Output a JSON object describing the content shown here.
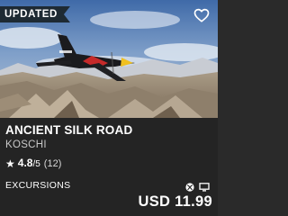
{
  "card": {
    "badge": "UPDATED",
    "title": "ANCIENT SILK ROAD",
    "publisher": "KOSCHI",
    "rating": {
      "score": "4.8",
      "out_of": "/5",
      "count": "(12)"
    },
    "category": "EXCURSIONS",
    "price": "USD 11.99",
    "platforms": [
      "xbox-icon",
      "pc-icon"
    ],
    "icons": {
      "wishlist": "heart-outline-icon",
      "star": "star-icon"
    },
    "colors": {
      "badge_bg": "#1e2a33",
      "card_bg": "#242424",
      "text": "#ffffff"
    }
  }
}
